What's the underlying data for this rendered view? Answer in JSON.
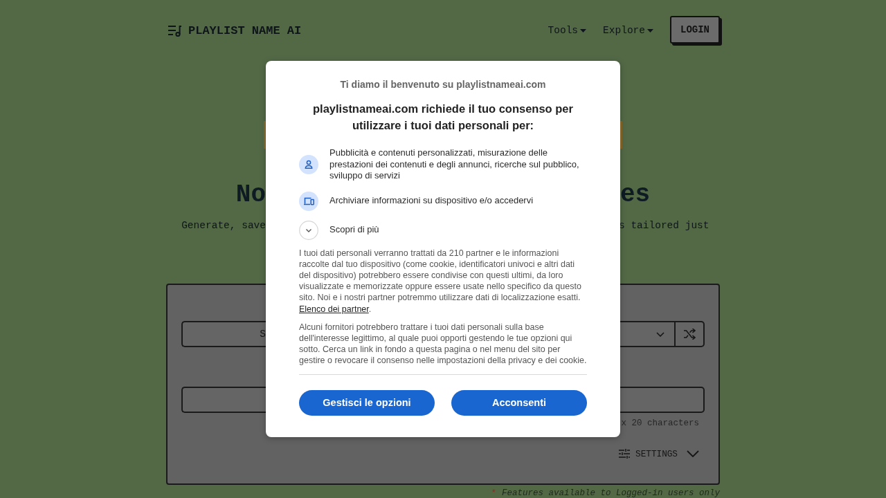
{
  "header": {
    "logo": "PLAYLIST NAME AI",
    "nav": [
      {
        "label": "Tools"
      },
      {
        "label": "Explore"
      }
    ],
    "login_button": "LOGIN"
  },
  "hero": {
    "title_parts": [
      "No",
      "es"
    ],
    "subtitle_parts": [
      "Generate, save",
      "s tailored just"
    ]
  },
  "generator": {
    "select_value_part": "S",
    "length_hint_part": "x 20 characters",
    "settings": {
      "label": "SETTINGS",
      "expanded": false
    }
  },
  "footnote": {
    "mark": "*",
    "text": "Features available to Logged-in users only"
  },
  "consent_dialog": {
    "welcome": "Ti diamo il benvenuto su playlistnameai.com",
    "heading": "playlistnameai.com richiede il tuo consenso per utilizzare i tuoi dati personali per:",
    "purposes": [
      {
        "kind": "personal",
        "text": "Pubblicità e contenuti personalizzati, misurazione delle prestazioni dei contenuti e degli annunci, ricerche sul pubblico, sviluppo di servizi"
      },
      {
        "kind": "device",
        "text": "Archiviare informazioni su dispositivo e/o accedervi"
      },
      {
        "kind": "expand",
        "text": "Scopri di più",
        "expanded": false
      }
    ],
    "paragraphs": [
      {
        "text": "I tuoi dati personali verranno trattati da 210 partner e le informazioni raccolte dal tuo dispositivo (come cookie, identificatori univoci e altri dati del dispositivo) potrebbero essere condivise con questi ultimi, da loro visualizzate e memorizzate oppure essere usate nello specifico da questo sito. Noi e i nostri partner potremmo utilizzare dati di localizzazione esatti.",
        "link": "Elenco dei partner",
        "link_suffix": "."
      },
      {
        "text": "Alcuni fornitori potrebbero trattare i tuoi dati personali sulla base dell'interesse legittimo, al quale puoi opporti gestendo le tue opzioni qui sotto. Cerca un link in fondo a questa pagina o nel menu del sito per gestire o revocare il consenso nelle impostazioni della privacy e dei cookie."
      }
    ],
    "buttons": [
      {
        "label": "Gestisci le opzioni"
      },
      {
        "label": "Acconsenti"
      }
    ]
  }
}
